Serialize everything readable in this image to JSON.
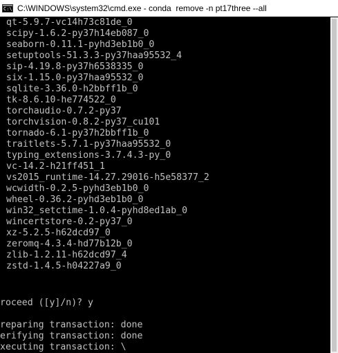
{
  "window": {
    "title": "C:\\WINDOWS\\system32\\cmd.exe - conda  remove -n pt17three --all"
  },
  "console": {
    "package_lines": [
      "qt-5.9.7-vc14h73c81de_0",
      "scipy-1.6.2-py37h14eb087_0",
      "seaborn-0.11.1-pyhd3eb1b0_0",
      "setuptools-51.3.3-py37haa95532_4",
      "sip-4.19.8-py37h6538335_0",
      "six-1.15.0-py37haa95532_0",
      "sqlite-3.36.0-h2bbff1b_0",
      "tk-8.6.10-he774522_0",
      "torchaudio-0.7.2-py37",
      "torchvision-0.8.2-py37_cu101",
      "tornado-6.1-py37h2bbff1b_0",
      "traitlets-5.7.1-py37haa95532_0",
      "typing_extensions-3.7.4.3-py_0",
      "vc-14.2-h21ff451_1",
      "vs2015_runtime-14.27.29016-h5e58377_2",
      "wcwidth-0.2.5-pyhd3eb1b0_0",
      "wheel-0.36.2-pyhd3eb1b0_0",
      "win32_setctime-1.0.4-pyhd8ed1ab_0",
      "wincertstore-0.2-py37_0",
      "xz-5.2.5-h62dcd97_0",
      "zeromq-4.3.4-hd77b12b_0",
      "zlib-1.2.11-h62dcd97_4",
      "zstd-1.4.5-h04227a9_0"
    ],
    "prompt_line": "roceed ([y]/n)? y",
    "status_lines": [
      "reparing transaction: done",
      "erifying transaction: done",
      "xecuting transaction: \\"
    ]
  },
  "colors": {
    "background": "#000000",
    "text": "#c0c0c0",
    "titlebar": "#ffffff"
  }
}
